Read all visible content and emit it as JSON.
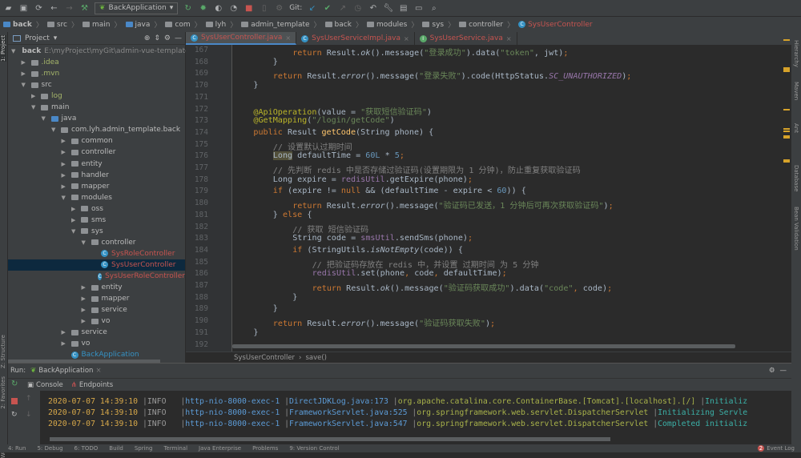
{
  "toolbar": {
    "run_config": "BackApplication",
    "git_label": "Git:"
  },
  "navbar": {
    "crumbs": [
      "back",
      "src",
      "main",
      "java",
      "com",
      "lyh",
      "admin_template",
      "back",
      "modules",
      "sys",
      "controller",
      "SysUserController"
    ]
  },
  "left_stripe": {
    "project": "1: Project",
    "structure": "Z: Structure",
    "favorites": "2: Favorites",
    "web": "Web"
  },
  "project": {
    "title": "Project",
    "root_label": "back",
    "root_path": "E:\\myProject\\myGit\\admin-vue-template\\b",
    "tree": [
      {
        "label": "back",
        "depth": 0,
        "arrow": "open",
        "type": "module"
      },
      {
        "label": ".idea",
        "depth": 1,
        "arrow": "closed",
        "type": "folder",
        "color": "#A5B56A"
      },
      {
        "label": ".mvn",
        "depth": 1,
        "arrow": "closed",
        "type": "folder",
        "color": "#A5B56A"
      },
      {
        "label": "src",
        "depth": 1,
        "arrow": "open",
        "type": "folder"
      },
      {
        "label": "log",
        "depth": 2,
        "arrow": "closed",
        "type": "folder",
        "color": "#A5B56A"
      },
      {
        "label": "main",
        "depth": 2,
        "arrow": "open",
        "type": "folder"
      },
      {
        "label": "java",
        "depth": 3,
        "arrow": "open",
        "type": "srcfolder"
      },
      {
        "label": "com.lyh.admin_template.back",
        "depth": 4,
        "arrow": "open",
        "type": "package"
      },
      {
        "label": "common",
        "depth": 5,
        "arrow": "closed",
        "type": "package"
      },
      {
        "label": "controller",
        "depth": 5,
        "arrow": "closed",
        "type": "package"
      },
      {
        "label": "entity",
        "depth": 5,
        "arrow": "closed",
        "type": "package"
      },
      {
        "label": "handler",
        "depth": 5,
        "arrow": "closed",
        "type": "package"
      },
      {
        "label": "mapper",
        "depth": 5,
        "arrow": "closed",
        "type": "package"
      },
      {
        "label": "modules",
        "depth": 5,
        "arrow": "open",
        "type": "package"
      },
      {
        "label": "oss",
        "depth": 6,
        "arrow": "closed",
        "type": "package"
      },
      {
        "label": "sms",
        "depth": 6,
        "arrow": "closed",
        "type": "package"
      },
      {
        "label": "sys",
        "depth": 6,
        "arrow": "open",
        "type": "package"
      },
      {
        "label": "controller",
        "depth": 7,
        "arrow": "open",
        "type": "package"
      },
      {
        "label": "SysRoleController",
        "depth": 8,
        "arrow": "none",
        "type": "class",
        "color": "#C75450"
      },
      {
        "label": "SysUserController",
        "depth": 8,
        "arrow": "none",
        "type": "class",
        "color": "#C75450",
        "selected": true
      },
      {
        "label": "SysUserRoleController",
        "depth": 8,
        "arrow": "none",
        "type": "class",
        "color": "#C75450"
      },
      {
        "label": "entity",
        "depth": 7,
        "arrow": "closed",
        "type": "package"
      },
      {
        "label": "mapper",
        "depth": 7,
        "arrow": "closed",
        "type": "package"
      },
      {
        "label": "service",
        "depth": 7,
        "arrow": "closed",
        "type": "package"
      },
      {
        "label": "vo",
        "depth": 7,
        "arrow": "closed",
        "type": "package"
      },
      {
        "label": "service",
        "depth": 5,
        "arrow": "closed",
        "type": "package"
      },
      {
        "label": "vo",
        "depth": 5,
        "arrow": "closed",
        "type": "package"
      },
      {
        "label": "BackApplication",
        "depth": 5,
        "arrow": "none",
        "type": "springclass",
        "color": "#3592C4"
      }
    ]
  },
  "tabs": [
    {
      "label": "SysUserController.java",
      "icon": "C",
      "active": true
    },
    {
      "label": "SysUserServiceImpl.java",
      "icon": "C",
      "active": false
    },
    {
      "label": "SysUserService.java",
      "icon": "I",
      "active": false
    }
  ],
  "editor": {
    "lines": [
      {
        "n": "167",
        "ind": 3,
        "segs": [
          [
            "return ",
            "kw"
          ],
          [
            "Result.",
            ""
          ],
          [
            "ok",
            "it"
          ],
          [
            "().message(",
            ""
          ],
          [
            "\"登录成功\"",
            "str"
          ],
          [
            ").data(",
            ""
          ],
          [
            "\"token\"",
            "str"
          ],
          [
            ", jwt)",
            ""
          ],
          [
            ";",
            "kw"
          ]
        ]
      },
      {
        "n": "168",
        "ind": 2,
        "segs": [
          [
            "}",
            ""
          ]
        ]
      },
      {
        "n": "169",
        "ind": 2,
        "segs": [
          [
            "return ",
            "kw"
          ],
          [
            "Result.",
            ""
          ],
          [
            "error",
            "it"
          ],
          [
            "().message(",
            ""
          ],
          [
            "\"登录失败\"",
            "str"
          ],
          [
            ").code(HttpStatus.",
            ""
          ],
          [
            "SC_UNAUTHORIZED",
            "fld it"
          ],
          [
            ")",
            ""
          ],
          [
            ";",
            "kw"
          ]
        ]
      },
      {
        "n": "170",
        "ind": 1,
        "segs": [
          [
            "}",
            ""
          ]
        ]
      },
      {
        "n": "171",
        "ind": 0,
        "segs": []
      },
      {
        "n": "172",
        "ind": 1,
        "segs": [
          [
            "@ApiOperation",
            "an"
          ],
          [
            "(value = ",
            ""
          ],
          [
            "\"获取短信验证码\"",
            "str"
          ],
          [
            ")",
            ""
          ]
        ]
      },
      {
        "n": "173",
        "ind": 1,
        "segs": [
          [
            "@GetMapping",
            "an"
          ],
          [
            "(",
            ""
          ],
          [
            "\"/login/getCode\"",
            "str"
          ],
          [
            ")",
            ""
          ]
        ]
      },
      {
        "n": "174",
        "ind": 1,
        "segs": [
          [
            "public ",
            "kw"
          ],
          [
            "Result ",
            ""
          ],
          [
            "getCode",
            "mth"
          ],
          [
            "(String phone) {",
            ""
          ]
        ]
      },
      {
        "n": "175",
        "ind": 2,
        "segs": [
          [
            "// 设置默认过期时间",
            "cm"
          ]
        ]
      },
      {
        "n": "176",
        "ind": 2,
        "segs": [
          [
            "Long",
            "hl"
          ],
          [
            " defaultTime = ",
            ""
          ],
          [
            "60L",
            "num"
          ],
          [
            " * ",
            ""
          ],
          [
            "5",
            "num"
          ],
          [
            ";",
            "kw"
          ]
        ]
      },
      {
        "n": "177",
        "ind": 2,
        "segs": [
          [
            "// 先判断 redis 中是否存储过验证码(设置期限为 1 分钟)，防止重复获取验证码",
            "cm"
          ]
        ]
      },
      {
        "n": "178",
        "ind": 2,
        "segs": [
          [
            "Long expire = ",
            ""
          ],
          [
            "redisUtil",
            "fld"
          ],
          [
            ".getExpire(phone)",
            ""
          ],
          [
            ";",
            "kw"
          ]
        ]
      },
      {
        "n": "179",
        "ind": 2,
        "segs": [
          [
            "if ",
            "kw"
          ],
          [
            "(expire != ",
            ""
          ],
          [
            "null ",
            "kw"
          ],
          [
            "&& (defaultTime - expire < ",
            ""
          ],
          [
            "60",
            "num"
          ],
          [
            ")) {",
            ""
          ]
        ]
      },
      {
        "n": "180",
        "ind": 3,
        "segs": [
          [
            "return ",
            "kw"
          ],
          [
            "Result.",
            ""
          ],
          [
            "error",
            "it"
          ],
          [
            "().message(",
            ""
          ],
          [
            "\"验证码已发送，1 分钟后可再次获取验证码\"",
            "str"
          ],
          [
            ")",
            ""
          ],
          [
            ";",
            "kw"
          ]
        ]
      },
      {
        "n": "181",
        "ind": 2,
        "segs": [
          [
            "} ",
            ""
          ],
          [
            "else ",
            "kw"
          ],
          [
            "{",
            ""
          ]
        ]
      },
      {
        "n": "182",
        "ind": 3,
        "segs": [
          [
            "// 获取 短信验证码",
            "cm"
          ]
        ]
      },
      {
        "n": "183",
        "ind": 3,
        "segs": [
          [
            "String code = ",
            ""
          ],
          [
            "smsUtil",
            "fld"
          ],
          [
            ".sendSms(phone)",
            ""
          ],
          [
            ";",
            "kw"
          ]
        ]
      },
      {
        "n": "184",
        "ind": 3,
        "segs": [
          [
            "if ",
            "kw"
          ],
          [
            "(StringUtils.",
            ""
          ],
          [
            "isNotEmpty",
            "it"
          ],
          [
            "(code)) {",
            ""
          ]
        ]
      },
      {
        "n": "185",
        "ind": 4,
        "segs": [
          [
            "// 把验证码存放在 redis 中，并设置 过期时间 为 5 分钟",
            "cm"
          ]
        ]
      },
      {
        "n": "186",
        "ind": 4,
        "segs": [
          [
            "redisUtil",
            "fld"
          ],
          [
            ".set(phone",
            ""
          ],
          [
            ", ",
            "kw"
          ],
          [
            "code",
            ""
          ],
          [
            ", ",
            "kw"
          ],
          [
            "defaultTime)",
            ""
          ],
          [
            ";",
            "kw"
          ]
        ]
      },
      {
        "n": "187",
        "ind": 4,
        "segs": [
          [
            "return ",
            "kw"
          ],
          [
            "Result.",
            ""
          ],
          [
            "ok",
            "it"
          ],
          [
            "().message(",
            ""
          ],
          [
            "\"验证码获取成功\"",
            "str"
          ],
          [
            ").data(",
            ""
          ],
          [
            "\"code\"",
            "str"
          ],
          [
            ", ",
            "kw"
          ],
          [
            "code)",
            ""
          ],
          [
            ";",
            "kw"
          ]
        ]
      },
      {
        "n": "188",
        "ind": 3,
        "segs": [
          [
            "}",
            ""
          ]
        ]
      },
      {
        "n": "189",
        "ind": 2,
        "segs": [
          [
            "}",
            ""
          ]
        ]
      },
      {
        "n": "190",
        "ind": 2,
        "segs": [
          [
            "return ",
            "kw"
          ],
          [
            "Result.",
            ""
          ],
          [
            "error",
            "it"
          ],
          [
            "().message(",
            ""
          ],
          [
            "\"验证码获取失败\"",
            "str"
          ],
          [
            ")",
            ""
          ],
          [
            ";",
            "kw"
          ]
        ]
      },
      {
        "n": "191",
        "ind": 1,
        "segs": [
          [
            "}",
            ""
          ]
        ]
      },
      {
        "n": "192",
        "ind": 0,
        "segs": []
      }
    ],
    "breadcrumb": {
      "class": "SysUserController",
      "method": "save()"
    }
  },
  "right_stripe": [
    "Hierarchy",
    "Maven",
    "Ant",
    "Database",
    "Bean Validation"
  ],
  "run": {
    "label": "Run:",
    "config": "BackApplication",
    "console_tab": "Console",
    "endpoints_tab": "Endpoints",
    "logs": [
      {
        "date": "2020-07-07 14:39:10",
        "level": "INFO",
        "thread": "http-nio-8000-exec-1",
        "source": "DirectJDKLog.java:173",
        "logger": "org.apache.catalina.core.ContainerBase.[Tomcat].[localhost].[/]",
        "msg": "Initializ"
      },
      {
        "date": "2020-07-07 14:39:10",
        "level": "INFO",
        "thread": "http-nio-8000-exec-1",
        "source": "FrameworkServlet.java:525",
        "logger": "org.springframework.web.servlet.DispatcherServlet",
        "msg": "Initializing Servle"
      },
      {
        "date": "2020-07-07 14:39:10",
        "level": "INFO",
        "thread": "http-nio-8000-exec-1",
        "source": "FrameworkServlet.java:547",
        "logger": "org.springframework.web.servlet.DispatcherServlet",
        "msg": "Completed initializ"
      }
    ]
  },
  "statusbar": {
    "items": [
      "4: Run",
      "5: Debug",
      "6: TODO",
      "Build",
      "Spring",
      "Terminal",
      "Java Enterprise",
      "Problems",
      "9: Version Control"
    ],
    "event_log": "Event Log",
    "event_count": "2"
  }
}
